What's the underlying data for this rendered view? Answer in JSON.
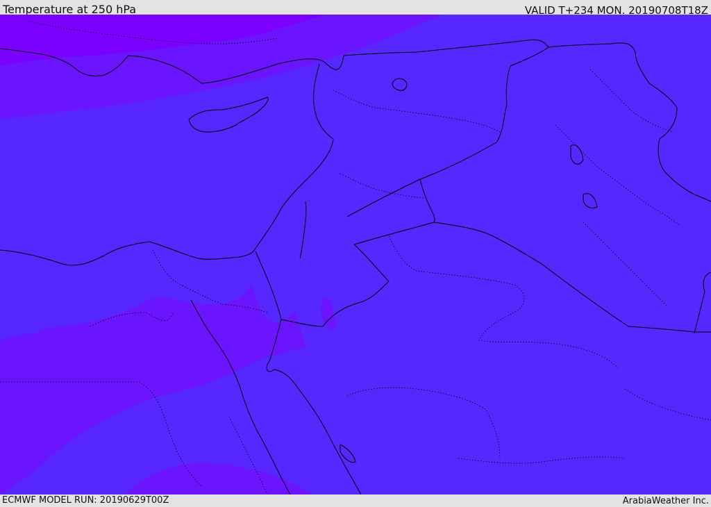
{
  "header": {
    "title": "Temperature at 250 hPa",
    "valid_time": "VALID T+234 MON. 20190708T18Z"
  },
  "footer": {
    "model_run": "ECMWF MODEL RUN: 20190629T00Z",
    "credit": "ArabiaWeather Inc."
  },
  "map": {
    "variable": "temperature",
    "level": "250 hPa",
    "region": "Eastern Mediterranean and Middle East",
    "fill_colors": {
      "cold_core": "#7a00ff",
      "colder": "#6a14ff",
      "base": "#5627ff"
    },
    "border_color": "#000000"
  }
}
